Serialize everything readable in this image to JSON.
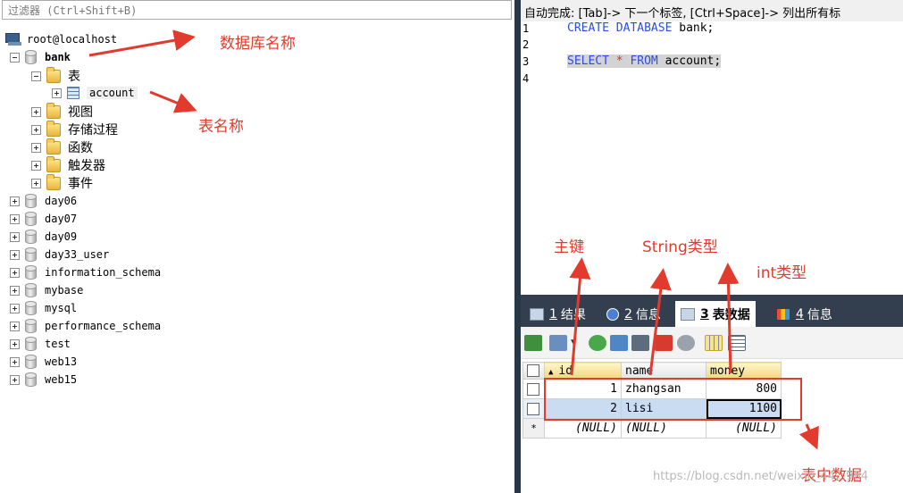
{
  "filter": {
    "placeholder": "过滤器 (Ctrl+Shift+B)"
  },
  "tree": {
    "server": "root@localhost",
    "database": "bank",
    "folder_tables": "表",
    "table": "account",
    "folders": [
      "视图",
      "存储过程",
      "函数",
      "触发器",
      "事件"
    ],
    "databases": [
      "day06",
      "day07",
      "day09",
      "day33_user",
      "information_schema",
      "mybase",
      "mysql",
      "performance_schema",
      "test",
      "web13",
      "web15"
    ]
  },
  "editor": {
    "hint": "自动完成: [Tab]-> 下一个标签, [Ctrl+Space]-> 列出所有标",
    "line_numbers": [
      "1",
      "2",
      "3",
      "4"
    ],
    "line1": {
      "kw1": "CREATE",
      "kw2": "DATABASE",
      "rest": " bank;"
    },
    "line3": {
      "kw1": "SELECT",
      "star": " * ",
      "kw2": "FROM",
      "rest": " account;"
    }
  },
  "results": {
    "tabs": [
      {
        "num": "1",
        "label": "结果"
      },
      {
        "num": "2",
        "label": "信息"
      },
      {
        "num": "3",
        "label": "表数据"
      },
      {
        "num": "4",
        "label": "信息"
      }
    ],
    "columns": [
      "id",
      "name",
      "money"
    ],
    "rows": [
      {
        "id": "1",
        "name": "zhangsan",
        "money": "800"
      },
      {
        "id": "2",
        "name": "lisi",
        "money": "1100"
      },
      {
        "id": "(NULL)",
        "name": "(NULL)",
        "money": "(NULL)"
      }
    ],
    "new_row_marker": "*"
  },
  "annotations": {
    "db_name": "数据库名称",
    "table_name": "表名称",
    "primary_key": "主键",
    "string_type": "String类型",
    "int_type": "int类型",
    "table_data": "表中数据",
    "watermark": "https://blog.csdn.net/weixin_44...964"
  },
  "colors": {
    "annotation": "#e23b2e",
    "keyword": "#2b4ee0",
    "tab_bar": "#333f4f",
    "divider": "#283646"
  }
}
